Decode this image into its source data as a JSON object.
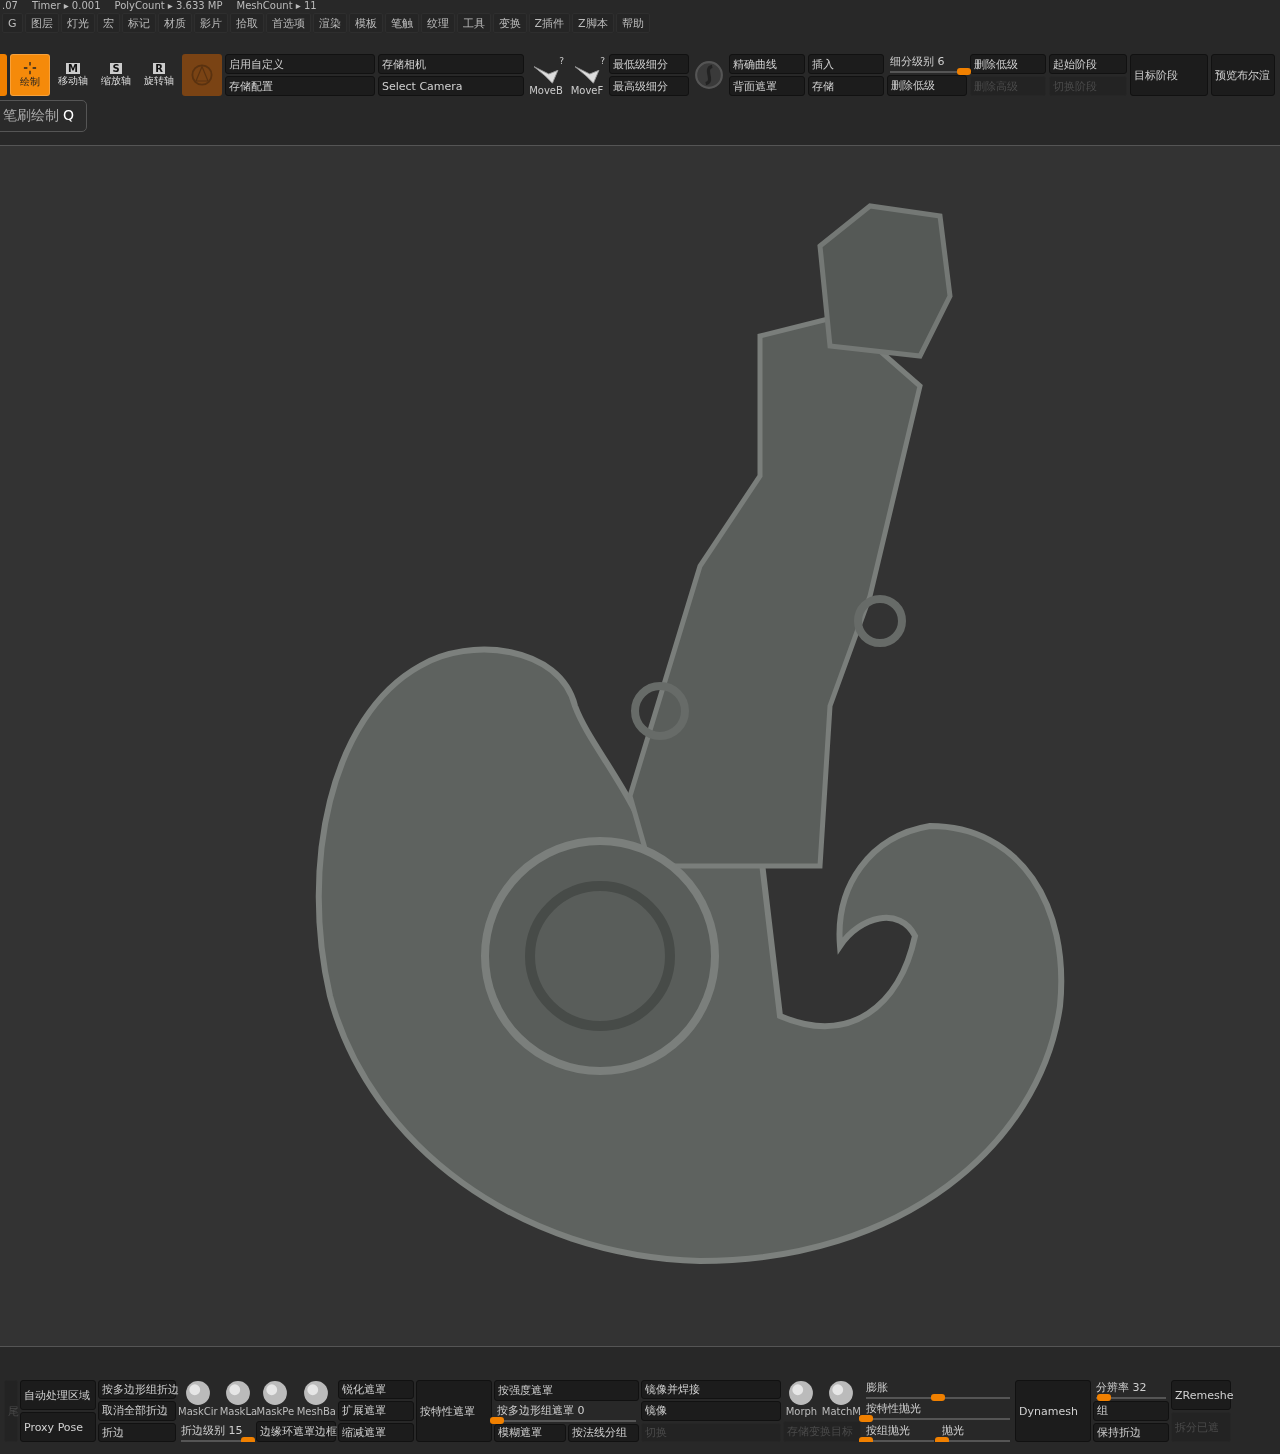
{
  "status_line": [
    ".07",
    "Timer ▸ 0.001",
    "PolyCount ▸ 3.633 MP",
    "MeshCount ▸ 11"
  ],
  "menu": [
    "G",
    "图层",
    "灯光",
    "宏",
    "标记",
    "材质",
    "影片",
    "拾取",
    "首选项",
    "渲染",
    "模板",
    "笔触",
    "纹理",
    "工具",
    "变换",
    "Z插件",
    "Z脚本",
    "帮助"
  ],
  "toolbar": {
    "groups": [
      {
        "items": [
          {
            "kind": "stub",
            "selected": true
          }
        ]
      },
      {
        "items": [
          {
            "kind": "tool",
            "label": "绘制",
            "selected": true
          }
        ]
      },
      {
        "items": [
          {
            "kind": "tool",
            "letter": "M",
            "label": "移动轴",
            "selected": false
          }
        ]
      },
      {
        "items": [
          {
            "kind": "tool",
            "letter": "S",
            "label": "缩放轴",
            "selected": false
          }
        ]
      },
      {
        "items": [
          {
            "kind": "tool",
            "letter": "R",
            "label": "旋转轴",
            "selected": false
          }
        ]
      },
      {
        "items": [
          {
            "kind": "swatch"
          }
        ]
      },
      {
        "items": [
          {
            "kind": "button",
            "label": "启用自定义",
            "disabled": false
          },
          {
            "kind": "button",
            "label": "存储配置",
            "disabled": false
          }
        ]
      },
      {
        "items": [
          {
            "kind": "button",
            "label": "存储相机",
            "disabled": false
          },
          {
            "kind": "button",
            "label": "Select Camera",
            "disabled": false
          }
        ]
      },
      {
        "items": [
          {
            "kind": "brush",
            "label": "MoveB",
            "hint": "?"
          }
        ]
      },
      {
        "items": [
          {
            "kind": "brush",
            "label": "MoveF",
            "hint": "?"
          }
        ]
      },
      {
        "items": [
          {
            "kind": "button",
            "label": "最低级细分",
            "disabled": false
          },
          {
            "kind": "button",
            "label": "最高级细分",
            "disabled": false
          }
        ]
      },
      {
        "items": [
          {
            "kind": "orb"
          }
        ]
      },
      {
        "items": [
          {
            "kind": "button",
            "label": "精确曲线",
            "disabled": false
          },
          {
            "kind": "button",
            "label": "背面遮罩",
            "disabled": false
          }
        ]
      },
      {
        "items": [
          {
            "kind": "button",
            "label": "插入",
            "disabled": false
          },
          {
            "kind": "button",
            "label": "存储",
            "disabled": false
          }
        ]
      },
      {
        "items": [
          {
            "kind": "slider",
            "label": "细分级别 6",
            "level": 1
          },
          {
            "kind": "button",
            "label": "删除低级",
            "disabled": false
          }
        ]
      },
      {
        "items": [
          {
            "kind": "button",
            "label": "删除低级",
            "disabled": false
          },
          {
            "kind": "button",
            "label": "删除高级",
            "disabled": true
          }
        ]
      },
      {
        "items": [
          {
            "kind": "button",
            "label": "起始阶段",
            "disabled": false
          },
          {
            "kind": "button",
            "label": "切换阶段",
            "disabled": true
          }
        ]
      },
      {
        "items": [
          {
            "kind": "button",
            "label": "目标阶段",
            "disabled": false
          }
        ]
      },
      {
        "items": [
          {
            "kind": "button",
            "label": "预览布尔渲",
            "disabled": false
          }
        ]
      }
    ]
  },
  "tooltip": {
    "label": "笔刷绘制",
    "key": "Q"
  },
  "bottom_bar": {
    "groups": [
      {
        "items": [
          {
            "kind": "button",
            "label": "尾",
            "disabled": true
          }
        ]
      },
      {
        "items": [
          {
            "kind": "button",
            "label": "自动处理区域",
            "disabled": false
          },
          {
            "kind": "button",
            "label": "Proxy Pose",
            "disabled": false
          }
        ]
      },
      {
        "items": [
          {
            "kind": "button",
            "label": "按多边形组折边",
            "disabled": false
          },
          {
            "kind": "button",
            "label": "取消全部折边",
            "disabled": false
          },
          {
            "kind": "button",
            "label": "折边",
            "disabled": false
          }
        ]
      },
      {
        "items": [
          {
            "kind": "thumbs",
            "thumbs": [
              {
                "label": "MaskCir"
              },
              {
                "label": "MaskLa"
              }
            ]
          },
          {
            "kind": "slider",
            "label": "折边级别 15",
            "level": 0.95
          }
        ]
      },
      {
        "items": [
          {
            "kind": "thumbs",
            "thumbs": [
              {
                "label": "MaskPe"
              },
              {
                "label": "MeshBa"
              }
            ]
          },
          {
            "kind": "button",
            "label": "边缘环遮罩边框",
            "disabled": false
          }
        ]
      },
      {
        "items": [
          {
            "kind": "button",
            "label": "锐化遮罩",
            "disabled": false
          },
          {
            "kind": "button",
            "label": "扩展遮罩",
            "disabled": false
          },
          {
            "kind": "button",
            "label": "缩减遮罩",
            "disabled": false
          }
        ]
      },
      {
        "items": [
          {
            "kind": "button",
            "label": "按特性遮罩",
            "disabled": false
          }
        ]
      },
      {
        "items": [
          {
            "kind": "button",
            "label": "按强度遮罩",
            "disabled": false
          },
          {
            "kind": "slider",
            "label": "按多边形组遮罩 0",
            "level": 0
          },
          {
            "kind": "pair",
            "items": [
              {
                "kind": "button",
                "label": "模糊遮罩",
                "disabled": false
              },
              {
                "kind": "button",
                "label": "按法线分组",
                "disabled": false
              }
            ]
          }
        ]
      },
      {
        "items": [
          {
            "kind": "button",
            "label": "镜像并焊接",
            "disabled": false
          },
          {
            "kind": "button",
            "label": "镜像",
            "disabled": false
          },
          {
            "kind": "button",
            "label": "切换",
            "disabled": true
          }
        ]
      },
      {
        "items": [
          {
            "kind": "thumbs",
            "thumbs": [
              {
                "label": "Morph"
              },
              {
                "label": "MatchM"
              }
            ]
          },
          {
            "kind": "button",
            "label": "存储变换目标",
            "disabled": true
          }
        ]
      },
      {
        "items": [
          {
            "kind": "slider",
            "label": "膨胀",
            "level": 0.5
          },
          {
            "kind": "slider",
            "label": "按特性抛光",
            "level": 0
          },
          {
            "kind": "pair",
            "items": [
              {
                "kind": "slider",
                "label": "按组抛光",
                "level": 0
              },
              {
                "kind": "slider",
                "label": "抛光",
                "level": 0
              }
            ]
          }
        ]
      },
      {
        "items": [
          {
            "kind": "button",
            "label": "Dynamesh",
            "disabled": false
          }
        ]
      },
      {
        "items": [
          {
            "kind": "slider",
            "label": "分辨率 32",
            "level": 0.12
          },
          {
            "kind": "button",
            "label": "组",
            "disabled": false
          },
          {
            "kind": "button",
            "label": "保持折边",
            "disabled": false
          }
        ]
      },
      {
        "items": [
          {
            "kind": "button",
            "label": "ZRemeshe",
            "disabled": false
          },
          {
            "kind": "button",
            "label": "拆分已遮",
            "disabled": true
          }
        ]
      }
    ]
  }
}
